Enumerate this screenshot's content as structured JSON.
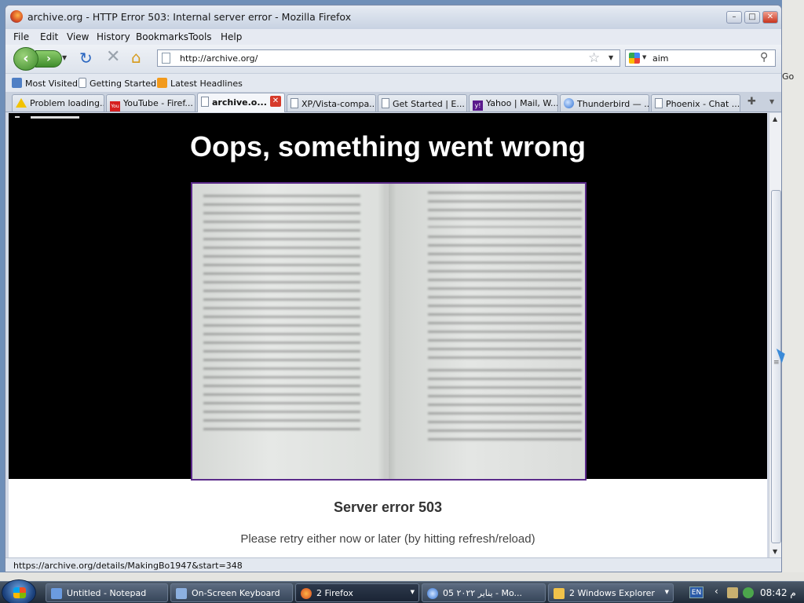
{
  "window": {
    "title": "archive.org - HTTP Error 503: Internal server error - Mozilla Firefox",
    "controls": [
      "minimize",
      "maximize",
      "close"
    ]
  },
  "menu": [
    "File",
    "Edit",
    "View",
    "History",
    "Bookmarks",
    "Tools",
    "Help"
  ],
  "nav": {
    "url": "http://archive.org/",
    "search_value": "aim",
    "search_engine": "google-icon"
  },
  "bookmarks": [
    "Most Visited",
    "Getting Started",
    "Latest Headlines"
  ],
  "tabs": [
    {
      "label": "Problem loading...",
      "icon": "warning-icon"
    },
    {
      "label": "YouTube - Firef...",
      "icon": "youtube-icon"
    },
    {
      "label": "archive.o...",
      "icon": "page-icon",
      "active": true
    },
    {
      "label": "XP/Vista-compa...",
      "icon": "page-icon"
    },
    {
      "label": "Get Started | E...",
      "icon": "page-icon"
    },
    {
      "label": "Yahoo | Mail, W...",
      "icon": "yahoo-icon"
    },
    {
      "label": "Thunderbird — ...",
      "icon": "thunderbird-icon"
    },
    {
      "label": "Phoenix - Chat ...",
      "icon": "page-icon"
    }
  ],
  "page": {
    "heading": "Oops, something went wrong",
    "error_title": "Server error 503",
    "error_message": "Please retry either now or later (by hitting refresh/reload)"
  },
  "status": {
    "text": "https://archive.org/details/MakingBo1947&start=348"
  },
  "desktop": {
    "go_label": "Go"
  },
  "taskbar": {
    "items": [
      {
        "label": "Untitled - Notepad",
        "icon": "notepad-icon"
      },
      {
        "label": "On-Screen Keyboard",
        "icon": "keyboard-icon"
      },
      {
        "label": "2 Firefox",
        "icon": "firefox-icon",
        "active": true
      },
      {
        "label": "05 يناير ٢٠٢٢ - Mo...",
        "icon": "thunderbird-icon"
      },
      {
        "label": "2 Windows Explorer",
        "icon": "folder-icon"
      }
    ],
    "language": "EN",
    "clock": "م 08:42"
  },
  "colors": {
    "page_band": "#000000",
    "heading": "#ffffff",
    "image_border": "#5b2a8a",
    "taskbar": "#1f2a38"
  }
}
